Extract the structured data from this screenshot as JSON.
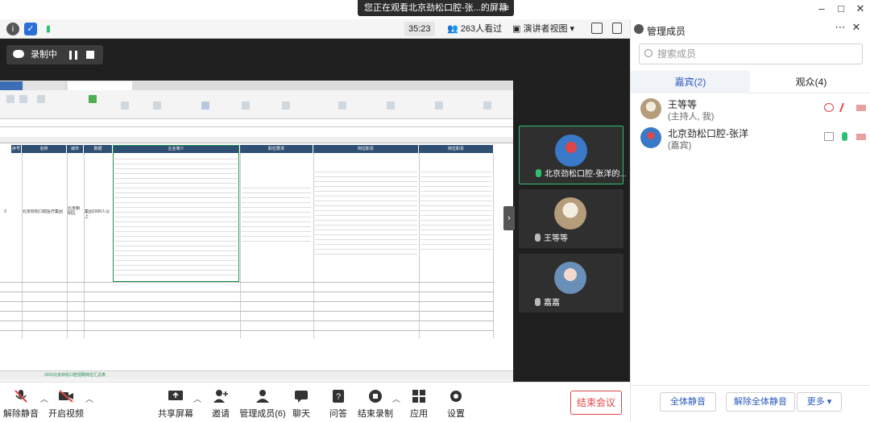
{
  "banner": {
    "text": "您正在观看北京劲松口腔-张...的屏幕"
  },
  "topbar": {
    "timer": "35:23",
    "viewers": "263人看过",
    "presenter_view": "演讲者视图"
  },
  "recording": {
    "label": "录制中"
  },
  "spreadsheet": {
    "headers": [
      "序号",
      "名称",
      "城市",
      "数据",
      "企业简介",
      "职位要求",
      "岗位职责",
      "岗位职责"
    ],
    "row_number": "3",
    "org_name": "北京劲松口腔医疗集团",
    "city": "北京朝阳区",
    "size": "集团1000人以上",
    "sheet_tab": "2022北京劲松口腔招聘岗位汇总表"
  },
  "tiles": [
    {
      "name": "北京劲松口腔-张洋的..."
    },
    {
      "name": "王等等"
    },
    {
      "name": "嘉嘉"
    }
  ],
  "controls": {
    "mute": "解除静音",
    "video": "开启视频",
    "share": "共享屏幕",
    "invite": "邀请",
    "members": "管理成员(6)",
    "chat": "聊天",
    "qa": "问答",
    "end_record": "结束录制",
    "apps": "应用",
    "settings": "设置",
    "end_meeting": "结束会议"
  },
  "panel": {
    "title": "管理成员",
    "search_placeholder": "搜索成员",
    "tab_guests": "嘉宾(2)",
    "tab_audience": "观众(4)",
    "members": [
      {
        "name": "王等等",
        "role": "(主持人, 我)"
      },
      {
        "name": "北京劲松口腔-张洋",
        "role": "(嘉宾)"
      }
    ],
    "mute_all": "全体静音",
    "unmute_all": "解除全体静音",
    "more": "更多"
  },
  "colors": {
    "accent": "#2a5bbf",
    "danger": "#e04646",
    "active_green": "#2fbf71",
    "stage_bg": "#1f1f1f"
  }
}
